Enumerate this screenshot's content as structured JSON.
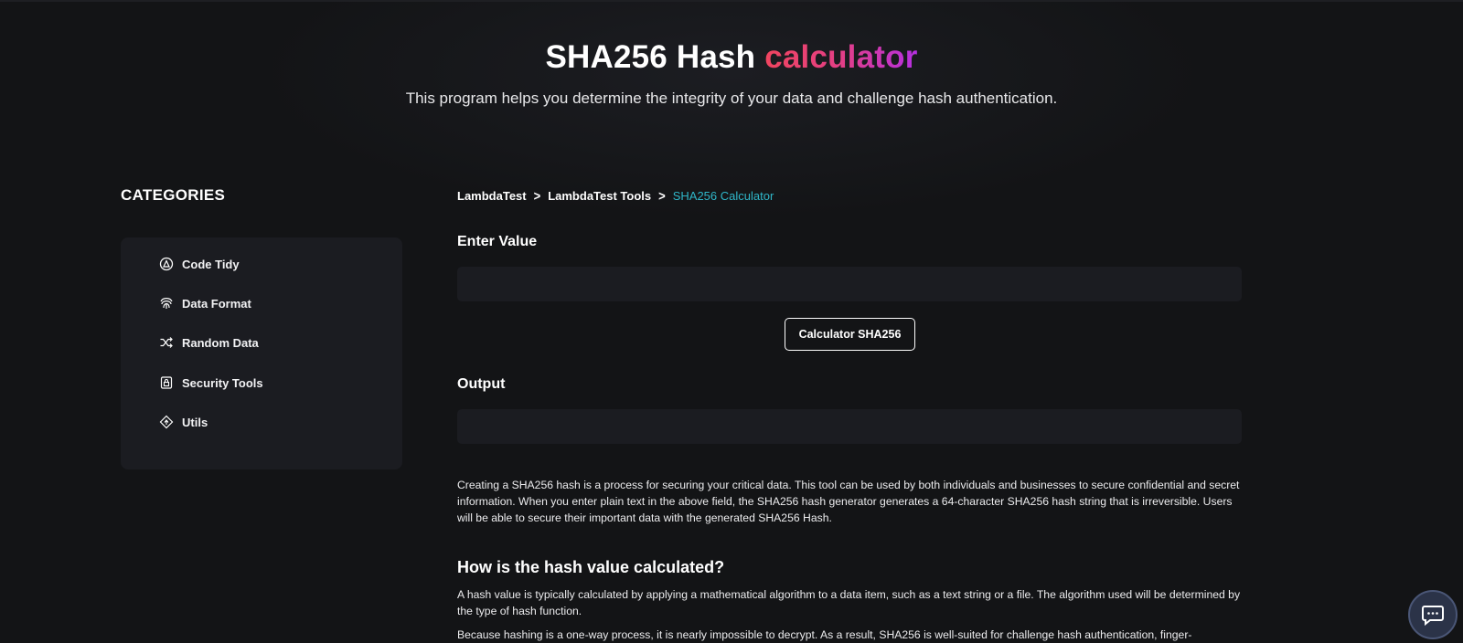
{
  "hero": {
    "title_main": "SHA256 Hash ",
    "title_accent": "calculator",
    "subtitle": "This program helps you determine the integrity of your data and challenge hash authentication."
  },
  "sidebar": {
    "heading": "CATEGORIES",
    "items": [
      {
        "label": "Code Tidy",
        "icon": "code-tidy-icon"
      },
      {
        "label": "Data Format",
        "icon": "fingerprint-icon"
      },
      {
        "label": "Random Data",
        "icon": "shuffle-icon"
      },
      {
        "label": "Security Tools",
        "icon": "lock-icon"
      },
      {
        "label": "Utils",
        "icon": "diamond-icon"
      }
    ]
  },
  "breadcrumb": {
    "items": [
      "LambdaTest",
      "LambdaTest Tools"
    ],
    "current": "SHA256 Calculator",
    "separator": ">"
  },
  "form": {
    "input_label": "Enter Value",
    "input_value": "",
    "button_label": "Calculator SHA256",
    "output_label": "Output",
    "output_value": ""
  },
  "content": {
    "intro": "Creating a SHA256 hash is a process for securing your critical data. This tool can be used by both individuals and businesses to secure confidential and secret information. When you enter plain text in the above field, the SHA256 hash generator generates a 64-character SHA256 hash string that is irreversible. Users will be able to secure their important data with the generated SHA256 Hash.",
    "section_heading": "How is the hash value calculated?",
    "section_p1": "A hash value is typically calculated by applying a mathematical algorithm to a data item, such as a text string or a file. The algorithm used will be determined by the type of hash function.",
    "section_p2": "Because hashing is a one-way process, it is nearly impossible to decrypt. As a result, SHA256 is well-suited for challenge hash authentication, finger-"
  },
  "colors": {
    "background": "#131416",
    "panel": "#1b1c21",
    "accent_link": "#2fb6c8",
    "gradient_start": "#f0455f",
    "gradient_end": "#b52fe3"
  },
  "chat": {
    "icon": "chat-icon"
  }
}
